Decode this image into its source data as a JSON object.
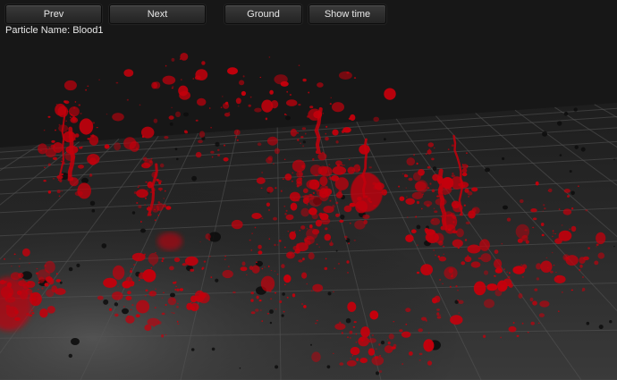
{
  "toolbar": {
    "prev_label": "Prev",
    "next_label": "Next",
    "ground_label": "Ground",
    "show_time_label": "Show time"
  },
  "info": {
    "particle_name_label": "Particle Name: Blood1"
  },
  "scene": {
    "effect": "blood splatter particle effect",
    "floor": "dark grey tiled floor with grid lines",
    "background_color": "#171717",
    "blood_color": "#c4000c",
    "debris_color": "#0d0d0d"
  }
}
